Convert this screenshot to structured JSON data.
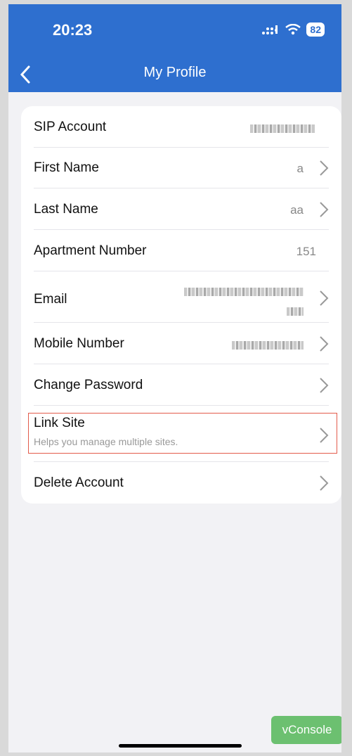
{
  "status": {
    "time": "20:23",
    "battery": "82"
  },
  "nav": {
    "title": "My Profile"
  },
  "rows": [
    {
      "label": "SIP Account",
      "value": ""
    },
    {
      "label": "First Name",
      "value": "a"
    },
    {
      "label": "Last Name",
      "value": "aa"
    },
    {
      "label": "Apartment Number",
      "value": "151"
    },
    {
      "label": "Email",
      "value": ""
    },
    {
      "label": "Mobile Number",
      "value": ""
    },
    {
      "label": "Change Password",
      "value": ""
    },
    {
      "label": "Link Site",
      "sub": "Helps you manage multiple sites."
    },
    {
      "label": "Delete Account",
      "value": ""
    }
  ],
  "vconsole": {
    "label": "vConsole"
  },
  "icons": {
    "back": "chevron-left-icon",
    "row": "chevron-right-icon"
  },
  "colors": {
    "header": "#2e6fcf",
    "highlight": "#e35b4b",
    "vconsole": "#6cc070"
  }
}
